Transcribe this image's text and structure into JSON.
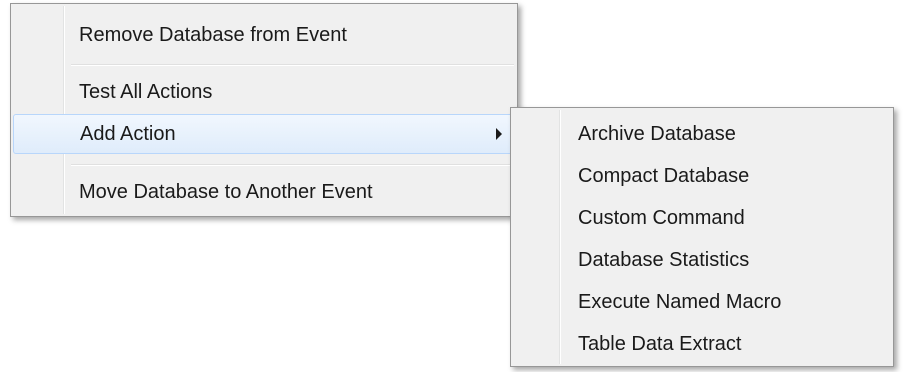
{
  "context_menu": {
    "items": [
      {
        "label": "Remove Database from Event"
      },
      {
        "label": "Test All Actions"
      },
      {
        "label": "Add Action",
        "has_submenu": true,
        "highlighted": true
      },
      {
        "label": "Move Database to Another Event"
      }
    ]
  },
  "submenu": {
    "items": [
      {
        "label": "Archive Database"
      },
      {
        "label": "Compact Database"
      },
      {
        "label": "Custom Command"
      },
      {
        "label": "Database Statistics"
      },
      {
        "label": "Execute Named Macro"
      },
      {
        "label": "Table Data Extract"
      }
    ]
  },
  "colors": {
    "menu_background": "#f0f0f0",
    "menu_border": "#979797",
    "highlight_border": "#b8d6fb",
    "highlight_background": "#dfecfb"
  }
}
